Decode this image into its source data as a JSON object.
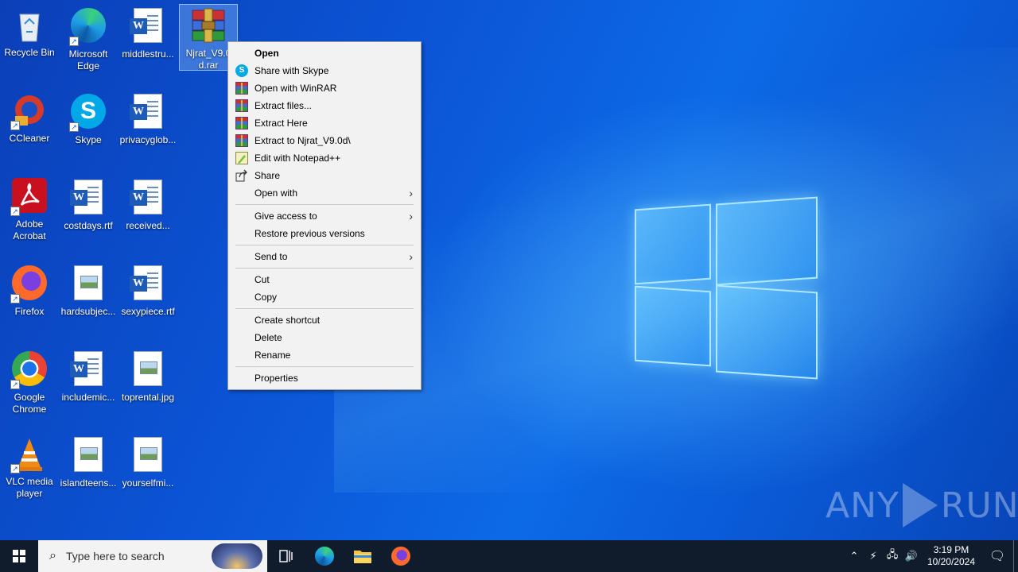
{
  "desktop": {
    "icons": [
      {
        "label": "Recycle Bin",
        "icon": "recycle-bin-icon"
      },
      {
        "label": "Microsoft Edge",
        "icon": "edge-icon"
      },
      {
        "label": "middlestru...",
        "icon": "word-doc-icon"
      },
      {
        "label": "Njrat_V9.0d.rar",
        "icon": "winrar-archive-icon"
      },
      {
        "label": "CCleaner",
        "icon": "ccleaner-icon"
      },
      {
        "label": "Skype",
        "icon": "skype-icon"
      },
      {
        "label": "privacyglob...",
        "icon": "word-doc-icon"
      },
      {
        "label": "Adobe Acrobat",
        "icon": "acrobat-icon"
      },
      {
        "label": "costdays.rtf",
        "icon": "word-doc-icon"
      },
      {
        "label": "received...",
        "icon": "word-doc-icon"
      },
      {
        "label": "Firefox",
        "icon": "firefox-icon"
      },
      {
        "label": "hardsubjec...",
        "icon": "image-file-icon"
      },
      {
        "label": "sexypiece.rtf",
        "icon": "word-doc-icon"
      },
      {
        "label": "Google Chrome",
        "icon": "chrome-icon"
      },
      {
        "label": "includemic...",
        "icon": "word-doc-icon"
      },
      {
        "label": "toprental.jpg",
        "icon": "image-file-icon"
      },
      {
        "label": "VLC media player",
        "icon": "vlc-icon"
      },
      {
        "label": "islandteens...",
        "icon": "image-file-icon"
      },
      {
        "label": "yourselfmi...",
        "icon": "image-file-icon"
      }
    ]
  },
  "context_menu": {
    "items": [
      {
        "label": "Open"
      },
      {
        "label": "Share with Skype",
        "icon": "skype-icon"
      },
      {
        "label": "Open with WinRAR",
        "icon": "winrar-icon"
      },
      {
        "label": "Extract files...",
        "icon": "winrar-icon"
      },
      {
        "label": "Extract Here",
        "icon": "winrar-icon"
      },
      {
        "label": "Extract to Njrat_V9.0d\\",
        "icon": "winrar-icon"
      },
      {
        "label": "Edit with Notepad++",
        "icon": "notepadpp-icon"
      },
      {
        "label": "Share",
        "icon": "share-icon"
      },
      {
        "label": "Open with"
      },
      {
        "label": "Give access to"
      },
      {
        "label": "Restore previous versions"
      },
      {
        "label": "Send to"
      },
      {
        "label": "Cut"
      },
      {
        "label": "Copy"
      },
      {
        "label": "Create shortcut"
      },
      {
        "label": "Delete"
      },
      {
        "label": "Rename"
      },
      {
        "label": "Properties"
      }
    ]
  },
  "taskbar": {
    "search_placeholder": "Type here to search",
    "clock_time": "3:19 PM",
    "clock_date": "10/20/2024"
  },
  "watermark": {
    "left": "ANY",
    "right": "RUN"
  }
}
